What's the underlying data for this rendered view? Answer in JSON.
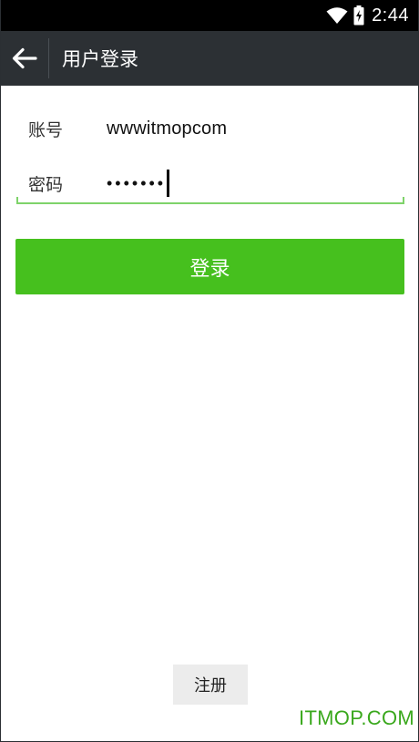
{
  "status_bar": {
    "time": "2:44",
    "icons": [
      "wifi-icon",
      "battery-charging-icon"
    ]
  },
  "action_bar": {
    "back_icon": "arrow-left-icon",
    "title": "用户登录"
  },
  "form": {
    "account": {
      "label": "账号",
      "value": "wwwitmopcom"
    },
    "password": {
      "label": "密码",
      "masked_value": "•••••••"
    }
  },
  "buttons": {
    "login_label": "登录",
    "register_label": "注册"
  },
  "watermark": "ITMOP.COM",
  "colors": {
    "status_bar": "#000000",
    "action_bar": "#2c3034",
    "accent_green": "#46c01e",
    "underline_green": "#7ed36a",
    "watermark_green": "#3aa81d",
    "register_bg": "#ececec"
  }
}
